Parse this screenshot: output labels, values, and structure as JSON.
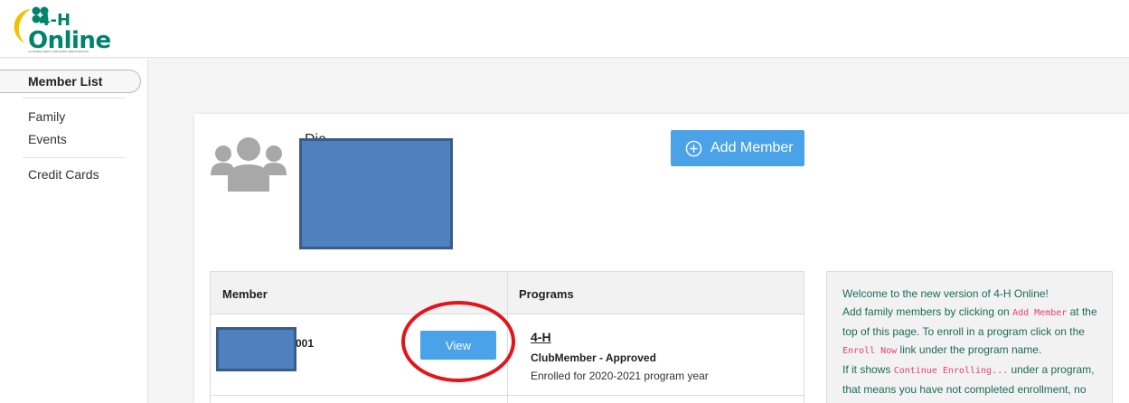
{
  "logo": {
    "line1": "4-H",
    "line2": "Online",
    "tagline": "4-H ENROLLMENT AND EVENT REGISTRATION",
    "colors": {
      "brand_green": "#00836a",
      "brand_gold": "#f2c200"
    }
  },
  "sidebar": {
    "items": [
      {
        "label": "Member List",
        "active": true
      },
      {
        "label": "Family"
      },
      {
        "label": "Events"
      },
      {
        "label": "Credit Cards"
      }
    ]
  },
  "family": {
    "icon": "people-group-icon",
    "name": "Dia"
  },
  "actions": {
    "add_member_label": "Add Member",
    "add_member_icon": "plus-circle-icon"
  },
  "members_table": {
    "headers": {
      "member": "Member",
      "programs": "Programs"
    },
    "rows": [
      {
        "member_id_visible": "001",
        "view_label": "View",
        "program": "4-H",
        "status": "ClubMember - Approved",
        "enrolled": "Enrolled for 2020-2021 program year"
      }
    ]
  },
  "info_panel": {
    "welcome": "Welcome to the new version of 4-H Online!",
    "p1_before": "Add family members by clicking on ",
    "add_member_code": "Add Member",
    "p1_after": " at the top of this page. To enroll in a program click on the ",
    "enroll_now_code": "Enroll Now",
    "p2_after": " link under the program name.",
    "p3_before": "If it shows ",
    "continue_code": "Continue Enrolling...",
    "p3_after": " under a program, that means you have not completed enrollment, no worries, just click on the link to"
  },
  "colors": {
    "button_blue": "#4aa3e8",
    "redaction_fill": "#4e81bd",
    "highlight_red": "#e3141b",
    "info_text": "#1a6b5a",
    "code_pink": "#e8426f"
  }
}
